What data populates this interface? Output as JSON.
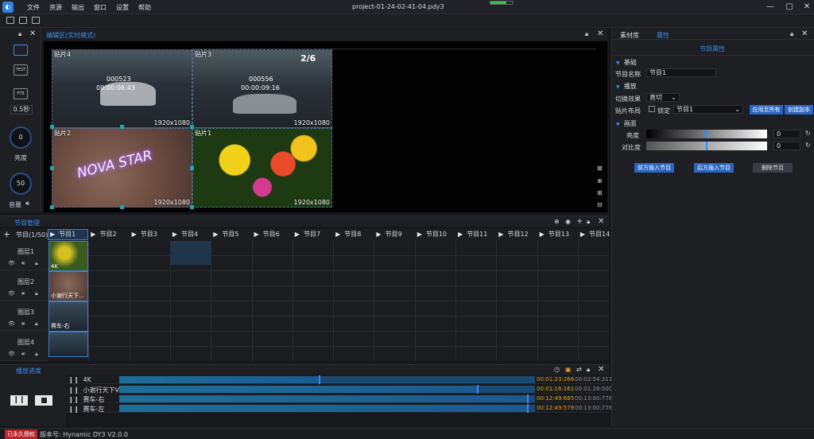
{
  "window": {
    "title": "project-01-24-02-41-04.pdy3"
  },
  "menu": [
    "文件",
    "资源",
    "输出",
    "窗口",
    "设置",
    "帮助"
  ],
  "left_toolbar": {
    "test_label": "TEST",
    "ftb_label": "FTB",
    "duration": "0.5秒",
    "brightness_value": "0",
    "brightness_label": "亮度",
    "volume_value": "50",
    "volume_label": "音量"
  },
  "edit_area": {
    "title": "编辑区(实时模式)"
  },
  "preview": {
    "tiles": [
      {
        "label": "贴片4",
        "res": "1920x1080"
      },
      {
        "label": "贴片3",
        "res": "1920x1080"
      },
      {
        "label": "贴片2",
        "res": "1920x1080"
      },
      {
        "label": "贴片1",
        "res": "1920x1080"
      }
    ],
    "race_hud": {
      "rank": "2/6",
      "left_score": "000523",
      "left_time": "00:00:06:43",
      "right_score": "000556",
      "right_time": "00:00:09:16"
    },
    "neon_text": "NOVA STAR"
  },
  "program_manager": {
    "title": "节目管理",
    "count": "节目(1/50)",
    "programs": [
      "节目1",
      "节目2",
      "节目3",
      "节目4",
      "节目5",
      "节目6",
      "节目7",
      "节目8",
      "节目9",
      "节目10",
      "节目11",
      "节目12",
      "节目13",
      "节目14"
    ]
  },
  "layers": [
    {
      "name": "图层1",
      "clip": "4K"
    },
    {
      "name": "图层2",
      "clip": "小谢行天下..."
    },
    {
      "name": "图层3",
      "clip": "赛车-右"
    },
    {
      "name": "图层4",
      "clip": ""
    }
  ],
  "playback": {
    "title": "播放进度",
    "rows": [
      {
        "name": "4K",
        "time": "00:01:23:266",
        "total": "00:02:54:311",
        "progress": 0.48
      },
      {
        "name": "小谢行天下V3....",
        "time": "00:01:16:161",
        "total": "00:01:28:000",
        "progress": 0.86
      },
      {
        "name": "赛车-右",
        "time": "00:12:49:685",
        "total": "00:13:00:778",
        "progress": 0.98
      },
      {
        "name": "赛车-左",
        "time": "00:12:49:579",
        "total": "00:13:00:778",
        "progress": 0.98
      }
    ]
  },
  "right_panel": {
    "tabs": [
      "素材库",
      "属性"
    ],
    "title": "节目属性",
    "basic": {
      "section": "基础",
      "name_label": "节目名称",
      "name_value": "节目1"
    },
    "play": {
      "section": "播放",
      "switch_label": "切换效果",
      "switch_value": "直切",
      "layout_label": "贴片布局",
      "lock_label": "锁定",
      "layout_value": "节目1",
      "apply_all": "应用至所有",
      "create_copy": "创建副本"
    },
    "picture": {
      "section": "画面",
      "brightness_label": "亮度",
      "brightness_value": "0",
      "contrast_label": "对比度",
      "contrast_value": "0"
    },
    "actions": {
      "insert_before": "前方插入节目",
      "insert_after": "后方插入节目",
      "delete": "删除节目"
    }
  },
  "status": {
    "license": "已永久授权",
    "version": "版本号: Hynamic DY3 V2.0.0"
  },
  "colors": {
    "accent": "#3b8cf0",
    "highlight": "#e3a21a",
    "license_bg": "#b8262c"
  }
}
